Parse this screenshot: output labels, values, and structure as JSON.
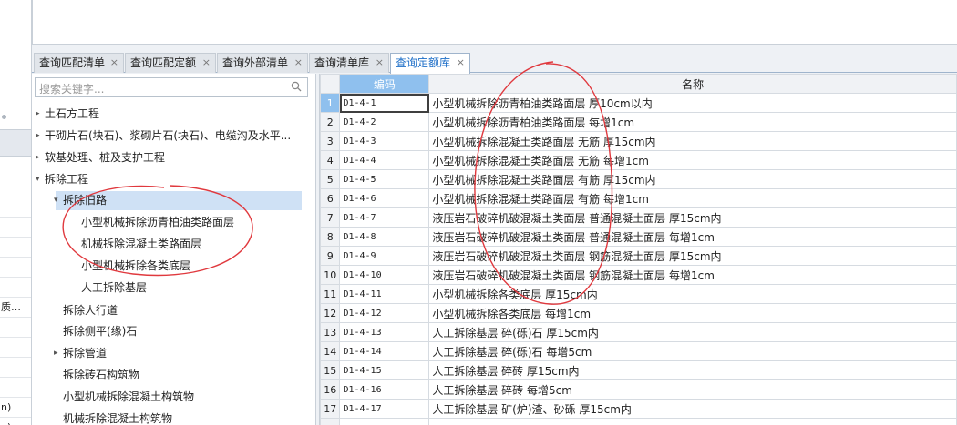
{
  "left_strip": {
    "cells": [
      "",
      "",
      "",
      "",
      "",
      "",
      "",
      "质…",
      "",
      "",
      "",
      "",
      "n)",
      "n)"
    ]
  },
  "tabs": [
    {
      "label": "查询匹配清单",
      "close": "×"
    },
    {
      "label": "查询匹配定额",
      "close": "×"
    },
    {
      "label": "查询外部清单",
      "close": "×"
    },
    {
      "label": "查询清单库",
      "close": "×"
    },
    {
      "label": "查询定额库",
      "close": "×"
    }
  ],
  "search": {
    "placeholder": "搜索关键字..."
  },
  "tree": [
    {
      "label": "土石方工程",
      "arrow": "▸"
    },
    {
      "label": "干砌片石(块石)、浆砌片石(块石)、电缆沟及水平...",
      "arrow": "▸"
    },
    {
      "label": "软基处理、桩及支护工程",
      "arrow": "▸"
    },
    {
      "label": "拆除工程",
      "arrow": "▾"
    },
    {
      "label": "拆除旧路",
      "arrow": "▾"
    },
    {
      "label": "小型机械拆除沥青柏油类路面层",
      "arrow": ""
    },
    {
      "label": "机械拆除混凝土类路面层",
      "arrow": ""
    },
    {
      "label": "小型机械拆除各类底层",
      "arrow": ""
    },
    {
      "label": "人工拆除基层",
      "arrow": ""
    },
    {
      "label": "拆除人行道",
      "arrow": ""
    },
    {
      "label": "拆除侧平(缘)石",
      "arrow": ""
    },
    {
      "label": "拆除管道",
      "arrow": "▸"
    },
    {
      "label": "拆除砖石构筑物",
      "arrow": ""
    },
    {
      "label": "小型机械拆除混凝土构筑物",
      "arrow": ""
    },
    {
      "label": "机械拆除混凝土构筑物",
      "arrow": ""
    }
  ],
  "grid": {
    "headers": {
      "code": "编码",
      "name": "名称"
    },
    "rows": [
      {
        "n": "1",
        "code": "D1-4-1",
        "name": "小型机械拆除沥青柏油类路面层 厚10cm以内"
      },
      {
        "n": "2",
        "code": "D1-4-2",
        "name": "小型机械拆除沥青柏油类路面层 每增1cm"
      },
      {
        "n": "3",
        "code": "D1-4-3",
        "name": "小型机械拆除混凝土类路面层 无筋 厚15cm内"
      },
      {
        "n": "4",
        "code": "D1-4-4",
        "name": "小型机械拆除混凝土类路面层 无筋 每增1cm"
      },
      {
        "n": "5",
        "code": "D1-4-5",
        "name": "小型机械拆除混凝土类路面层 有筋 厚15cm内"
      },
      {
        "n": "6",
        "code": "D1-4-6",
        "name": "小型机械拆除混凝土类路面层 有筋 每增1cm"
      },
      {
        "n": "7",
        "code": "D1-4-7",
        "name": "液压岩石破碎机破混凝土类面层 普通混凝土面层 厚15cm内"
      },
      {
        "n": "8",
        "code": "D1-4-8",
        "name": "液压岩石破碎机破混凝土类面层 普通混凝土面层 每增1cm"
      },
      {
        "n": "9",
        "code": "D1-4-9",
        "name": "液压岩石破碎机破混凝土类面层 钢筋混凝土面层 厚15cm内"
      },
      {
        "n": "10",
        "code": "D1-4-10",
        "name": "液压岩石破碎机破混凝土类面层 钢筋混凝土面层 每增1cm"
      },
      {
        "n": "11",
        "code": "D1-4-11",
        "name": "小型机械拆除各类底层 厚15cm内"
      },
      {
        "n": "12",
        "code": "D1-4-12",
        "name": "小型机械拆除各类底层 每增1cm"
      },
      {
        "n": "13",
        "code": "D1-4-13",
        "name": "人工拆除基层 碎(砾)石 厚15cm内"
      },
      {
        "n": "14",
        "code": "D1-4-14",
        "name": "人工拆除基层 碎(砾)石 每增5cm"
      },
      {
        "n": "15",
        "code": "D1-4-15",
        "name": "人工拆除基层 碎砖 厚15cm内"
      },
      {
        "n": "16",
        "code": "D1-4-16",
        "name": "人工拆除基层 碎砖 每增5cm"
      },
      {
        "n": "17",
        "code": "D1-4-17",
        "name": "人工拆除基层 矿(炉)渣、砂砾 厚15cm内"
      },
      {
        "n": "",
        "code": "",
        "name": ""
      }
    ]
  },
  "colors": {
    "accent": "#1e6fc8",
    "header_highlight": "#8fc0ee",
    "selection": "#cfe1f5",
    "annotation": "#e0393e"
  }
}
